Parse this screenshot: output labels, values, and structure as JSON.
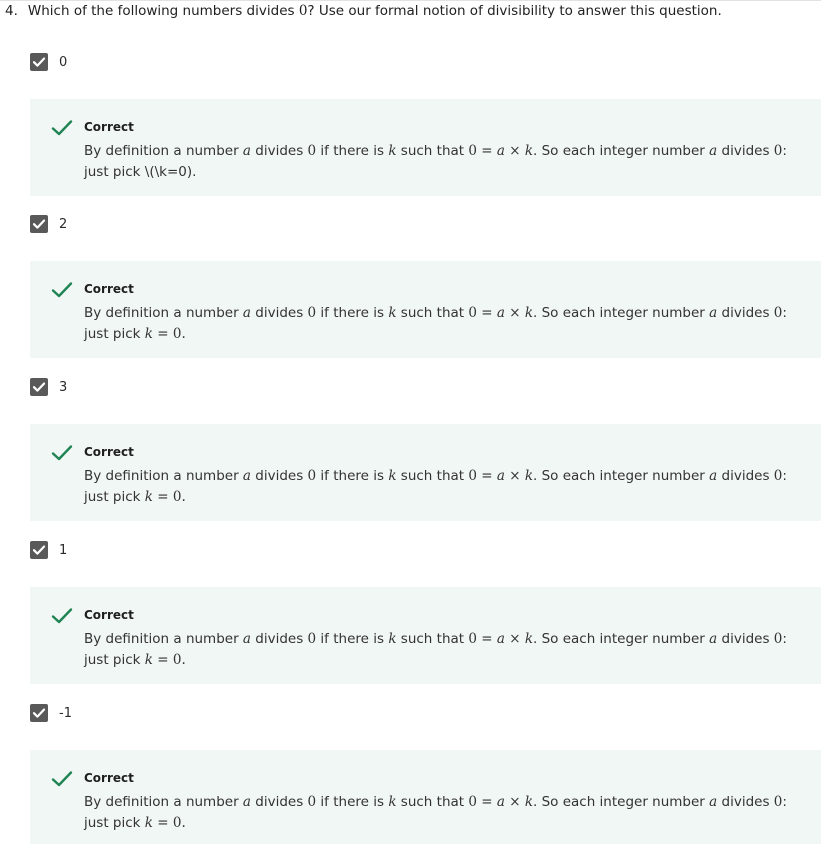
{
  "question": {
    "number": "4.",
    "text_before": "Which of the following numbers divides ",
    "zero": "0",
    "text_after": "? Use our formal notion of divisibility to answer this question."
  },
  "colors": {
    "checkbox": "#595959",
    "feedback_bg": "#f1f7f4",
    "correct_green": "#1f8354"
  },
  "icons": {
    "checkbox": "checkbox-checked-icon",
    "feedback": "checkmark-icon"
  },
  "options": [
    {
      "label": "0",
      "checked": true,
      "feedback": {
        "title": "Correct",
        "p1": "By definition a number ",
        "a1": "a",
        "p2": " divides ",
        "z1": "0",
        "p3": " if there is ",
        "k1": "k",
        "p4": " such that ",
        "eq_lhs": "0 = ",
        "eq_a": "a",
        "eq_times": " × ",
        "eq_k": "k",
        "p5": ". So each integer number ",
        "a2": "a",
        "p6": " divides ",
        "z2": "0",
        "p7": ": just pick ",
        "tail": "\\(\\k=0)."
      }
    },
    {
      "label": "2",
      "checked": true,
      "feedback": {
        "title": "Correct",
        "p1": "By definition a number ",
        "a1": "a",
        "p2": " divides ",
        "z1": "0",
        "p3": " if there is ",
        "k1": "k",
        "p4": " such that ",
        "eq_lhs": "0 = ",
        "eq_a": "a",
        "eq_times": " × ",
        "eq_k": "k",
        "p5": ". So each integer number ",
        "a2": "a",
        "p6": " divides ",
        "z2": "0",
        "p7": ": just pick ",
        "k2": "k",
        "eq2": " = 0."
      }
    },
    {
      "label": "3",
      "checked": true,
      "feedback": {
        "title": "Correct",
        "p1": "By definition a number ",
        "a1": "a",
        "p2": " divides ",
        "z1": "0",
        "p3": " if there is ",
        "k1": "k",
        "p4": " such that ",
        "eq_lhs": "0 = ",
        "eq_a": "a",
        "eq_times": " × ",
        "eq_k": "k",
        "p5": ". So each integer number ",
        "a2": "a",
        "p6": " divides ",
        "z2": "0",
        "p7": ": just pick ",
        "k2": "k",
        "eq2": " = 0."
      }
    },
    {
      "label": "1",
      "checked": true,
      "feedback": {
        "title": "Correct",
        "p1": "By definition a number ",
        "a1": "a",
        "p2": " divides ",
        "z1": "0",
        "p3": " if there is ",
        "k1": "k",
        "p4": " such that ",
        "eq_lhs": "0 = ",
        "eq_a": "a",
        "eq_times": " × ",
        "eq_k": "k",
        "p5": ". So each integer number ",
        "a2": "a",
        "p6": " divides ",
        "z2": "0",
        "p7": ": just pick ",
        "k2": "k",
        "eq2": " = 0."
      }
    },
    {
      "label": "-1",
      "checked": true,
      "feedback": {
        "title": "Correct",
        "p1": "By definition a number ",
        "a1": "a",
        "p2": " divides ",
        "z1": "0",
        "p3": " if there is ",
        "k1": "k",
        "p4": " such that ",
        "eq_lhs": "0 = ",
        "eq_a": "a",
        "eq_times": " × ",
        "eq_k": "k",
        "p5": ". So each integer number ",
        "a2": "a",
        "p6": " divides ",
        "z2": "0",
        "p7": ": just pick ",
        "k2": "k",
        "eq2": " = 0."
      }
    }
  ]
}
